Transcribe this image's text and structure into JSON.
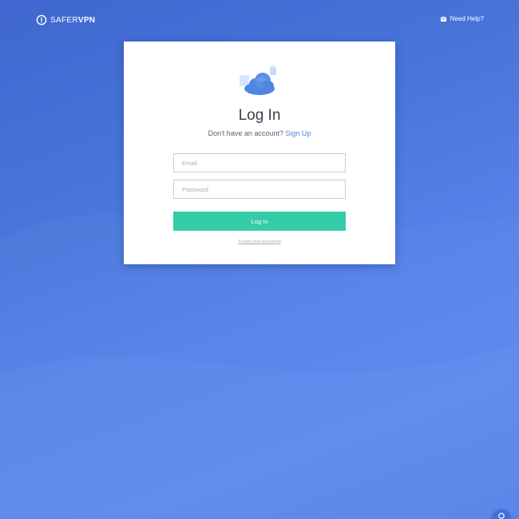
{
  "header": {
    "logo_light": "SAFER",
    "logo_bold": "VPN",
    "help_label": "Need Help?"
  },
  "login_card": {
    "title": "Log In",
    "signup_prompt": "Don't have an account?",
    "signup_link": "Sign Up",
    "email_placeholder": "Email",
    "email_value": "",
    "password_placeholder": "Password",
    "password_value": "",
    "login_button": "Log In",
    "forgot_password": "Forgot your password"
  },
  "icons": {
    "logo": "shield-icon",
    "help": "mail-icon",
    "illustration": "cloud-icon",
    "chat": "chat-icon"
  },
  "colors": {
    "background": "#4a77dc",
    "accent_button": "#35cda9",
    "link": "#4a82d8",
    "title_text": "#3a3f4a"
  }
}
